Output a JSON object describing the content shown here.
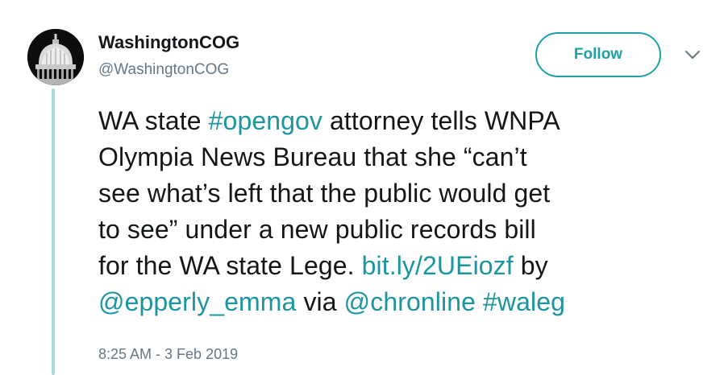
{
  "colors": {
    "accent": "#1b95a0",
    "thread_line": "#a8dadc",
    "secondary_text": "#657786"
  },
  "author": {
    "name": "WashingtonCOG",
    "handle": "@WashingtonCOG",
    "avatar_icon": "capitol-dome-icon"
  },
  "follow_button": {
    "label": "Follow"
  },
  "menu_icon": "chevron-down-icon",
  "tweet": {
    "line1": {
      "t1": "WA state ",
      "h1": "#opengov",
      "t2": " attorney tells WNPA"
    },
    "line2": "Olympia News Bureau that she “can’t",
    "line3": "see what’s left that the public would get",
    "line4": "to see” under a new public records bill",
    "line5": {
      "t1": "for the WA state Lege. ",
      "url": "bit.ly/2UEiozf",
      "t2": " by"
    },
    "line6": {
      "m1": "@epperly_emma",
      "t1": " via ",
      "m2": "@chronline",
      "t2": " ",
      "h2": "#waleg"
    }
  },
  "timestamp": "8:25 AM - 3 Feb 2019"
}
